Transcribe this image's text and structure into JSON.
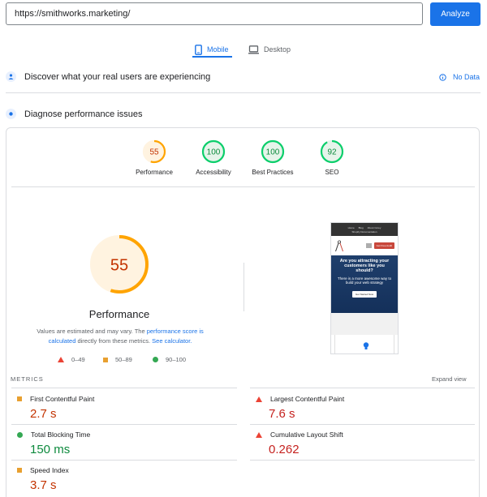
{
  "search": {
    "url": "https://smithworks.marketing/",
    "analyze_label": "Analyze"
  },
  "tabs": [
    {
      "label": "Mobile",
      "icon": "mobile-icon"
    },
    {
      "label": "Desktop",
      "icon": "desktop-icon"
    }
  ],
  "crux": {
    "title": "Discover what your real users are experiencing",
    "status": "No Data"
  },
  "diagnose": {
    "title": "Diagnose performance issues"
  },
  "categories": [
    {
      "label": "Performance",
      "score": "55",
      "score_value": 55,
      "color": "#ffa400"
    },
    {
      "label": "Accessibility",
      "score": "100",
      "score_value": 100,
      "color": "#0cce6b"
    },
    {
      "label": "Best Practices",
      "score": "100",
      "score_value": 100,
      "color": "#0cce6b"
    },
    {
      "label": "SEO",
      "score": "92",
      "score_value": 92,
      "color": "#0cce6b"
    }
  ],
  "performance": {
    "score": "55",
    "score_value": 55,
    "title": "Performance",
    "disclaimer_prefix": "Values are estimated and may vary. The ",
    "disclaimer_link1": "performance score is calculated",
    "disclaimer_middle": " directly from these metrics. ",
    "disclaimer_link2": "See calculator."
  },
  "legend": [
    {
      "range": "0–49",
      "shape": "triangle"
    },
    {
      "range": "50–89",
      "shape": "square"
    },
    {
      "range": "90–100",
      "shape": "circle"
    }
  ],
  "screenshot": {
    "nav_items": [
      "Home",
      "Blog",
      "About Corey"
    ],
    "nav_sub": "Shopify Documentation",
    "cta_small": "Get Free Audit",
    "hero_title": "Are you attracting your customers like you should?",
    "hero_sub": "There is a more awesome way to build your web strategy",
    "hero_button": "Get Started Now"
  },
  "metrics": {
    "label": "METRICS",
    "expand": "Expand view",
    "items": [
      {
        "name": "First Contentful Paint",
        "value": "2.7 s",
        "rating": "average"
      },
      {
        "name": "Largest Contentful Paint",
        "value": "7.6 s",
        "rating": "fail"
      },
      {
        "name": "Total Blocking Time",
        "value": "150 ms",
        "rating": "pass"
      },
      {
        "name": "Cumulative Layout Shift",
        "value": "0.262",
        "rating": "fail"
      },
      {
        "name": "Speed Index",
        "value": "3.7 s",
        "rating": "average"
      }
    ]
  },
  "colors": {
    "accent": "#1a73e8",
    "pass": "#0cce6b",
    "average": "#ffa400",
    "fail": "#ff4e42",
    "pass_text": "#0d8a3d",
    "average_text": "#c33300",
    "fail_text": "#c5221f"
  }
}
